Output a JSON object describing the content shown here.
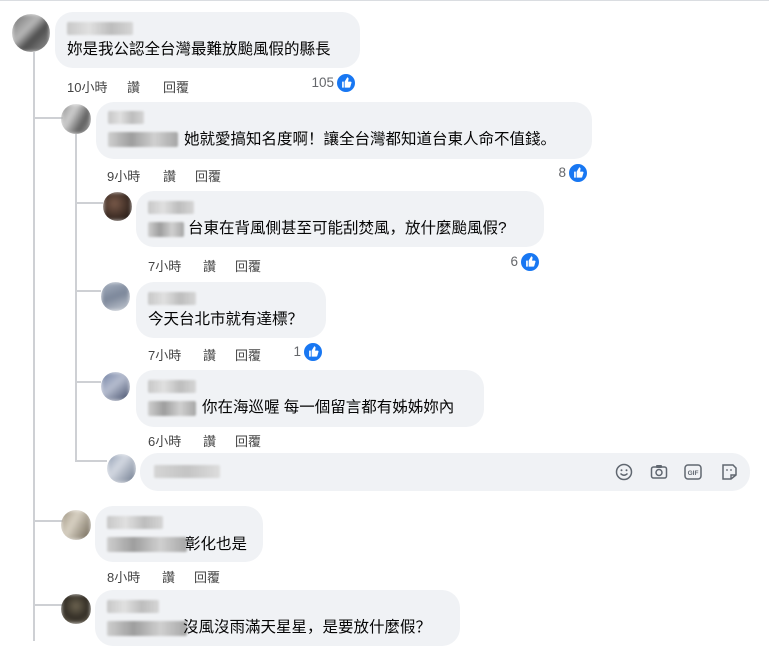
{
  "comments": [
    {
      "text": "妳是我公認全台灣最難放颱風假的縣長",
      "time": "10小時",
      "action_read": "讚",
      "action_reply": "回覆",
      "likes": "105"
    },
    {
      "text": "她就愛搞知名度啊！讓全台灣都知道台東人命不值錢。",
      "time": "9小時",
      "action_read": "讚",
      "action_reply": "回覆",
      "likes": "8"
    },
    {
      "text": "台東在背風側甚至可能刮焚風，放什麼颱風假?",
      "time": "7小時",
      "action_read": "讚",
      "action_reply": "回覆",
      "likes": "6"
    },
    {
      "text": "今天台北市就有達標？",
      "time": "7小時",
      "action_read": "讚",
      "action_reply": "回覆",
      "likes": "1"
    },
    {
      "text": "你在海巡喔 每一個留言都有姊姊妳內",
      "time": "6小時",
      "action_read": "讚",
      "action_reply": "回覆"
    },
    {
      "text": "彰化也是",
      "time": "8小時",
      "action_read": "讚",
      "action_reply": "回覆"
    },
    {
      "text": "沒風沒雨滿天星星，是要放什麼假？"
    }
  ],
  "composer": {
    "icons": [
      "emoji-icon",
      "camera-icon",
      "gif-icon",
      "sticker-icon"
    ],
    "gif_label": "GIF"
  },
  "colors": {
    "like_blue": "#1877f2",
    "bubble": "#f0f2f5",
    "thread": "#ced0d4"
  }
}
